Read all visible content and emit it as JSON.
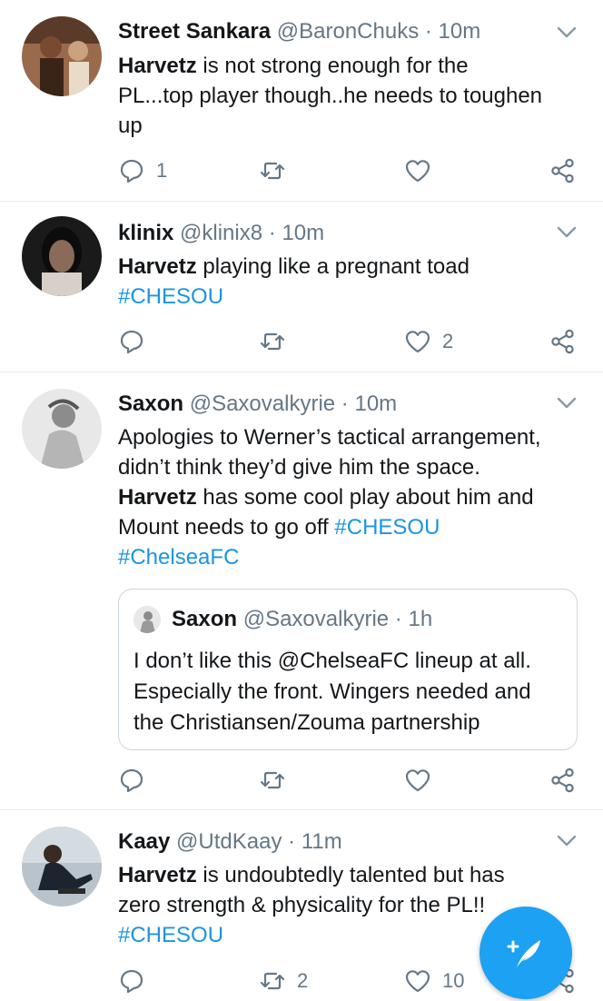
{
  "tweets": [
    {
      "name": "Street Sankara",
      "handle": "@BaronChuks",
      "separator": "·",
      "time": "10m",
      "keyword": "Harvetz",
      "text_line1": " is not strong enough for the",
      "text_line2": "PL...top player though..he needs to toughen",
      "text_line3": "up",
      "reply_count": "1",
      "retweet_count": "",
      "like_count": ""
    },
    {
      "name": "klinix",
      "handle": "@klinix8",
      "separator": "·",
      "time": "10m",
      "keyword": "Harvetz",
      "text_line1": " playing like a pregnant toad",
      "hashtag": "#CHESOU",
      "reply_count": "",
      "retweet_count": "",
      "like_count": "2"
    },
    {
      "name": "Saxon",
      "handle": "@Saxovalkyrie",
      "separator": "·",
      "time": "10m",
      "text_line1": "Apologies to Werner’s tactical arrangement,",
      "text_line2": "didn’t think they’d give him the space.",
      "keyword": "Harvetz",
      "text_line3": " has some cool play about him and",
      "text_line4": "Mount needs to go off ",
      "hashtag1": "#CHESOU",
      "hashtag2": "#ChelseaFC",
      "quote": {
        "name": "Saxon",
        "handle": "@Saxovalkyrie",
        "separator": "·",
        "time": "1h",
        "line1": "I don’t like this @ChelseaFC lineup at all.",
        "line2": "Especially the front. Wingers needed and",
        "line3": "the Christiansen/Zouma partnership"
      },
      "reply_count": "",
      "retweet_count": "",
      "like_count": ""
    },
    {
      "name": "Kaay",
      "handle": "@UtdKaay",
      "separator": "·",
      "time": "11m",
      "keyword": "Harvetz",
      "text_line1": " is undoubtedly talented but has",
      "text_line2": "zero strength & physicality for the PL!!",
      "hashtag": "#CHESOU",
      "reply_count": "",
      "retweet_count": "2",
      "like_count": "10"
    }
  ],
  "colors": {
    "accent": "#1da1f2",
    "link": "#1b95e0",
    "muted": "#657786",
    "divider": "#e6ecf0"
  },
  "icons": [
    "reply-icon",
    "retweet-icon",
    "like-icon",
    "share-icon",
    "chevron-down-icon",
    "compose-icon"
  ]
}
